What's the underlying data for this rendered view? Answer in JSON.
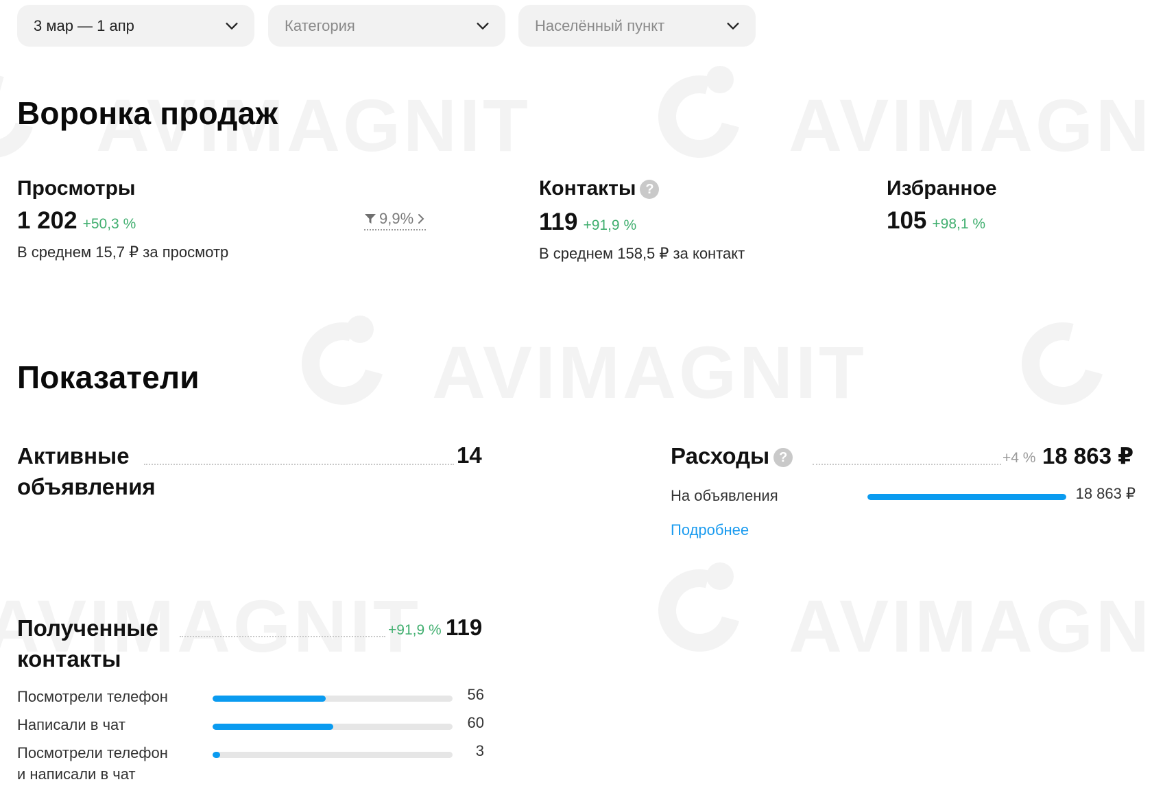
{
  "filters": {
    "period": "3 мар — 1 апр",
    "category": "Категория",
    "city": "Населённый пункт"
  },
  "watermark": "AVIMAGNIT",
  "funnel": {
    "title": "Воронка продаж",
    "views": {
      "title": "Просмотры",
      "value": "1 202",
      "delta": "+50,3 %",
      "sub": "В среднем 15,7 ₽ за просмотр",
      "conversion": "9,9%"
    },
    "contacts": {
      "title": "Контакты",
      "value": "119",
      "delta": "+91,9 %",
      "sub": "В среднем 158,5 ₽ за контакт"
    },
    "favorites": {
      "title": "Избранное",
      "value": "105",
      "delta": "+98,1 %"
    }
  },
  "indicators": {
    "title": "Показатели",
    "active_ads": {
      "title_line1": "Активные",
      "title_line2": "объявления",
      "value": "14"
    },
    "expenses": {
      "title": "Расходы",
      "delta": "+4 %",
      "value": "18 863 ₽",
      "rows": [
        {
          "label": "На объявления",
          "value": "18 863 ₽",
          "fraction": 1.0
        }
      ],
      "more_link": "Подробнее"
    },
    "contacts_received": {
      "title_line1": "Полученные",
      "title_line2": "контакты",
      "delta": "+91,9 %",
      "value": "119",
      "rows": [
        {
          "label": "Посмотрели телефон",
          "value": "56",
          "fraction": 0.47
        },
        {
          "label": "Написали в чат",
          "value": "60",
          "fraction": 0.504
        },
        {
          "label": "Посмотрели телефон и написали в чат",
          "label_line1": "Посмотрели телефон",
          "label_line2": "и написали в чат",
          "value": "3",
          "fraction": 0.03
        }
      ]
    }
  },
  "colors": {
    "accent_blue": "#0a9bf0",
    "delta_green": "#3fae6e",
    "filter_bg": "#f2f2f2"
  },
  "icons": {
    "filter_chevron": "chevron-down-icon",
    "help": "question-circle-icon",
    "funnel": "funnel-icon",
    "chevron_right": "chevron-right-icon"
  }
}
